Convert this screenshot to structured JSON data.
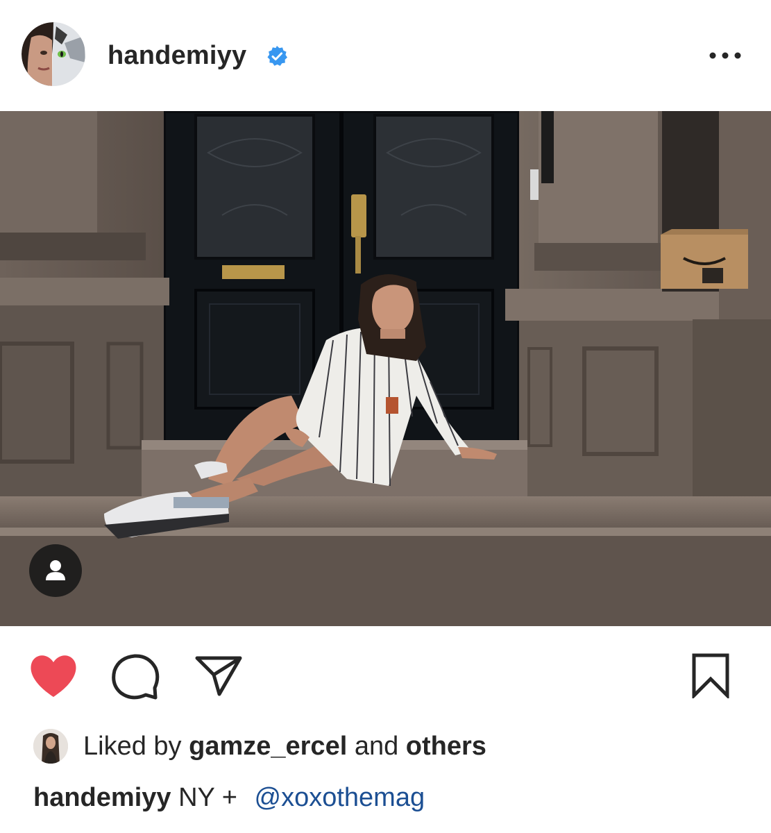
{
  "post": {
    "username": "handemiyy",
    "verified": true,
    "more_icon": "more-horizontal-icon"
  },
  "photo": {
    "subject": "photo",
    "tag_icon": "person-icon"
  },
  "actions": {
    "like_icon": "heart-filled-icon",
    "comment_icon": "comment-bubble-icon",
    "share_icon": "paper-plane-icon",
    "save_icon": "bookmark-icon",
    "liked": true
  },
  "likes": {
    "prefix": "Liked by",
    "user": "gamze_ercel",
    "and": "and",
    "others": "others"
  },
  "caption": {
    "user": "handemiyy",
    "text": "NY +",
    "mention": "@xoxothemag"
  },
  "colors": {
    "like_red": "#ed4956",
    "verified_blue": "#3897f0",
    "mention_blue": "#1c4f93",
    "text": "#262626"
  }
}
